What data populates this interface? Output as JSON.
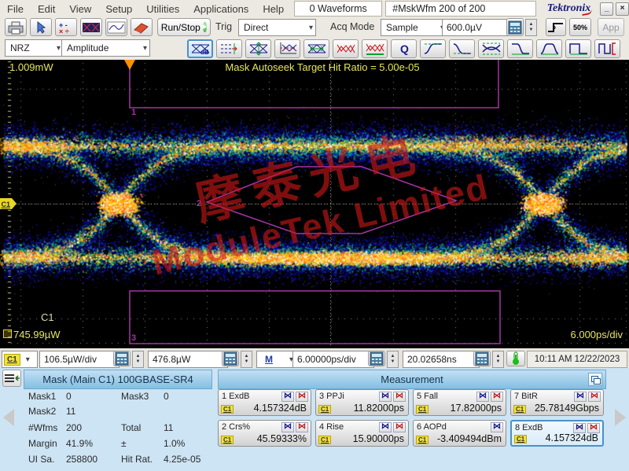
{
  "menu": {
    "items": [
      "File",
      "Edit",
      "View",
      "Setup",
      "Utilities",
      "Applications",
      "Help"
    ]
  },
  "titlebar": {
    "waveforms": "0 Waveforms",
    "mask_counter": "#MskWfm  200 of 200",
    "brand": "Tektronix",
    "minimize_label": "_",
    "close_label": "×"
  },
  "toolbar1": {
    "icons": [
      "printer",
      "pointer",
      "calculator",
      "mask-test",
      "waveform",
      "eraser"
    ],
    "run_stop_label": "Run/Stop",
    "trig_label": "Trig",
    "trig_value": "Direct",
    "acq_mode_label": "Acq Mode",
    "acq_mode_value": "Sample",
    "trig_level_value": "600.0µV",
    "fifty_percent_label": "50%",
    "app_label": "App"
  },
  "toolbar2": {
    "signal_type": "NRZ",
    "measure_category": "Amplitude",
    "icons": [
      "eye-db",
      "extinction-level",
      "eye-height",
      "crossing-level",
      "eye-width",
      "jitter-pp",
      "jitter-rms",
      "q-factor",
      "rise-time",
      "fall-time",
      "eye-window",
      "fall-edge",
      "rise-edge",
      "pulse-width",
      "nrz-frame"
    ],
    "active_icon": "eye-db"
  },
  "display": {
    "top_scale": "1.009mW",
    "autoseek_text": "Mask Autoseek Target Hit Ratio = 5.00e-05",
    "channel_name": "C1",
    "channel_marker": "C1",
    "offset_value": "745.99µW",
    "timebase": "6.000ps/div",
    "mask_labels": {
      "m1": "1",
      "m2": "2",
      "m3": "3"
    },
    "watermark_cn": "摩泰光电",
    "watermark_en": "ModuleTek Limited"
  },
  "controlbar": {
    "channel": "C1",
    "vertical_scale": "106.5µW/div",
    "vertical_offset": "476.8µW",
    "timebase_mode": "M",
    "horizontal_scale": "6.00000ps/div",
    "delay": "20.02658ns",
    "datetime": "10:11 AM 12/22/2023"
  },
  "mask_panel": {
    "title": "Mask (Main  C1) 100GBASE-SR4",
    "rows": [
      {
        "l1": "Mask1",
        "v1": "0",
        "l2": "Mask3",
        "v2": "0"
      },
      {
        "l1": "Mask2",
        "v1": "11",
        "l2": "",
        "v2": ""
      },
      {
        "l1": "#Wfms",
        "v1": "200",
        "l2": "Total",
        "v2": "11"
      },
      {
        "l1": "Margin",
        "v1": "41.9%",
        "l2": "±",
        "v2": "1.0%"
      },
      {
        "l1": "UI Sa.",
        "v1": "258800",
        "l2": "Hit Rat.",
        "v2": "4.25e-05"
      }
    ]
  },
  "measurement_panel": {
    "title": "Measurement",
    "tiles": [
      {
        "label": "1 ExdB",
        "source": "C1",
        "value": "4.157324dB",
        "icons": 2,
        "active": false
      },
      {
        "label": "3 PPJi",
        "source": "C1",
        "value": "11.82000ps",
        "icons": 2,
        "active": false
      },
      {
        "label": "5 Fall",
        "source": "C1",
        "value": "17.82000ps",
        "icons": 2,
        "active": false
      },
      {
        "label": "7 BitR",
        "source": "C1",
        "value": "25.78149Gbps",
        "icons": 2,
        "active": false
      },
      {
        "label": "2 Crs%",
        "source": "C1",
        "value": "45.59333%",
        "icons": 2,
        "active": false
      },
      {
        "label": "4 Rise",
        "source": "C1",
        "value": "15.90000ps",
        "icons": 2,
        "active": false
      },
      {
        "label": "6 AOPd",
        "source": "C1",
        "value": "-3.409494dBm",
        "icons": 1,
        "active": false
      },
      {
        "label": "8 ExdB",
        "source": "C1",
        "value": "4.157324dB",
        "icons": 2,
        "active": true
      }
    ]
  },
  "colors": {
    "mask_magenta": "#a335a3",
    "channel_yellow": "#f0e13e",
    "trigger_orange": "#ff9000",
    "readout_yellow": "#e6e65a",
    "watermark_red": "#cd1616",
    "panel_blue": "#cde4f4",
    "header_blue": "#84bfe2"
  }
}
